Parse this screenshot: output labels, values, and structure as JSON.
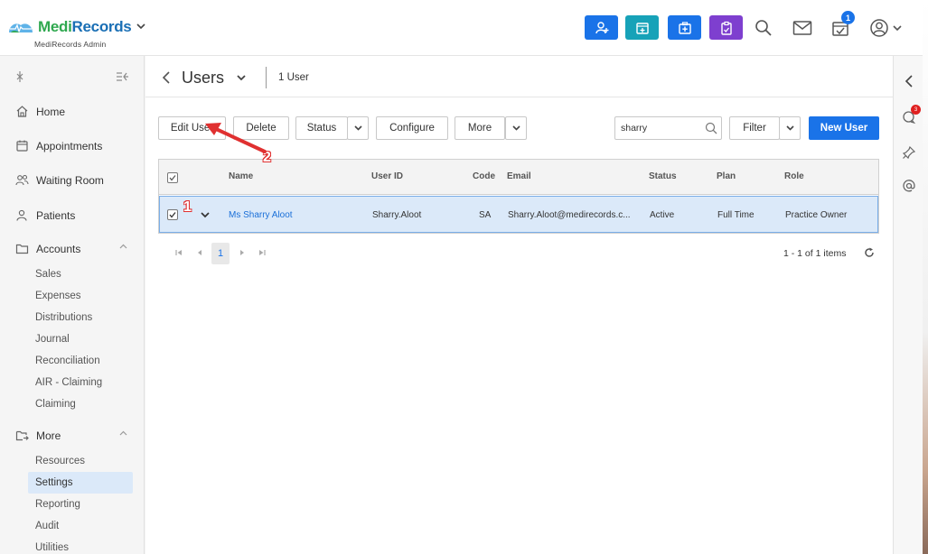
{
  "app": {
    "brand_part1": "Medi",
    "brand_part2": "Records",
    "subtitle": "MediRecords Admin",
    "notification_count": "1",
    "colors": {
      "primary": "#1a73e8",
      "teal": "#17a2b8",
      "purple": "#7e3fcf",
      "green": "#2fa84f",
      "navy": "#1a6fb5"
    }
  },
  "toolbar_icons": [
    "add-patient-icon",
    "calendar-icon",
    "medical-case-icon",
    "clipboard-icon",
    "search-icon",
    "mail-icon",
    "calendar-check-icon",
    "user-account-icon"
  ],
  "sidebar": {
    "nav": [
      {
        "label": "Home",
        "icon": "home-icon"
      },
      {
        "label": "Appointments",
        "icon": "calendar-icon"
      },
      {
        "label": "Waiting Room",
        "icon": "users-icon"
      },
      {
        "label": "Patients",
        "icon": "user-icon"
      },
      {
        "label": "Accounts",
        "icon": "folder-icon"
      }
    ],
    "accounts_sub": [
      "Sales",
      "Expenses",
      "Distributions",
      "Journal",
      "Reconciliation",
      "AIR - Claiming",
      "Claiming"
    ],
    "more_label": "More",
    "more_sub": [
      "Resources",
      "Settings",
      "Reporting",
      "Audit",
      "Utilities"
    ]
  },
  "header": {
    "title": "Users",
    "count": "1 User"
  },
  "actions": {
    "edit": "Edit User",
    "delete": "Delete",
    "status": "Status",
    "configure": "Configure",
    "more": "More",
    "search_value": "sharry",
    "filter": "Filter",
    "new_user": "New User"
  },
  "grid": {
    "columns": [
      "Name",
      "User ID",
      "Code",
      "Email",
      "Status",
      "Plan",
      "Role"
    ],
    "rows": [
      {
        "name": "Ms Sharry Aloot",
        "user_id": "Sharry.Aloot",
        "code": "SA",
        "email": "Sharry.Aloot@medirecords.c...",
        "status": "Active",
        "plan": "Full Time",
        "role": "Practice Owner"
      }
    ]
  },
  "pager": {
    "page": "1",
    "info": "1 - 1 of 1 items"
  },
  "annotations": {
    "step1": "1",
    "step2": "2"
  },
  "right_rail": {
    "chat_badge": "3"
  }
}
